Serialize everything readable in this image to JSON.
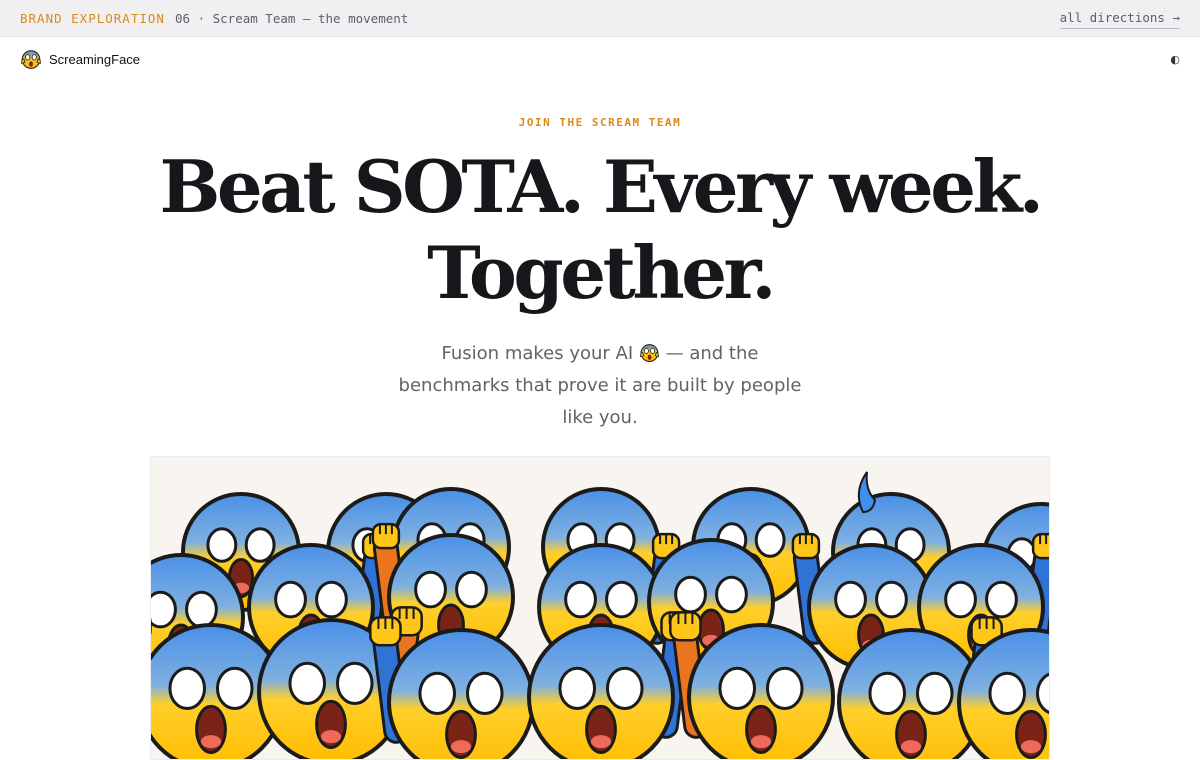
{
  "topbar": {
    "tag": "BRAND EXPLORATION",
    "crumb": "06 · Scream Team — the movement",
    "all_directions": "all directions →"
  },
  "nav": {
    "brand_icon": "screaming-face-icon",
    "brand_name": "ScreamingFace",
    "theme_toggle": "◐"
  },
  "hero": {
    "eyebrow": "JOIN THE SCREAM TEAM",
    "headline_line1": "Beat SOTA. Every week.",
    "headline_line2": "Together.",
    "sub_before": "Fusion makes your AI",
    "sub_after": "— and the benchmarks that prove it are built by people like you.",
    "sub_icon": "screaming-face-icon",
    "illustration": "crowd-of-screaming-faces-raising-fists"
  },
  "colors": {
    "accent": "#d98a1d",
    "face_yellow": "#ffc61a",
    "face_blue": "#4a90e8",
    "mouth": "#7a2418",
    "arm_blue": "#2f73d6",
    "arm_orange": "#e9761e"
  }
}
